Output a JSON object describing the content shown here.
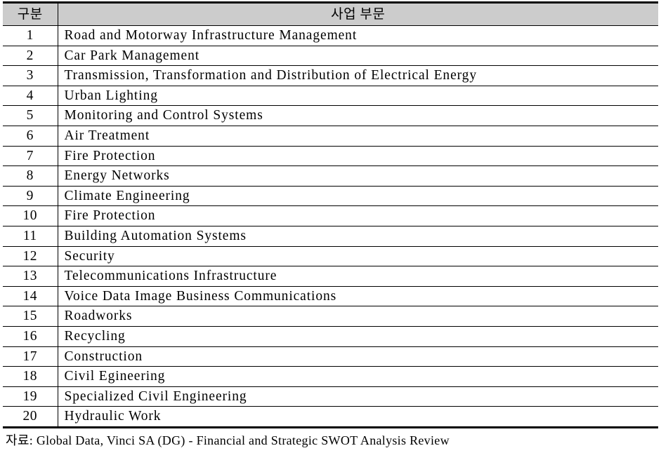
{
  "table": {
    "columns": [
      {
        "key": "no",
        "label": "구분"
      },
      {
        "key": "label",
        "label": "사업 부문"
      }
    ],
    "rows": [
      {
        "no": "1",
        "label": "Road and Motorway Infrastructure Management"
      },
      {
        "no": "2",
        "label": "Car Park Management"
      },
      {
        "no": "3",
        "label": "Transmission, Transformation and Distribution of Electrical Energy"
      },
      {
        "no": "4",
        "label": "Urban Lighting"
      },
      {
        "no": "5",
        "label": "Monitoring and Control Systems"
      },
      {
        "no": "6",
        "label": "Air Treatment"
      },
      {
        "no": "7",
        "label": "Fire Protection"
      },
      {
        "no": "8",
        "label": "Energy Networks"
      },
      {
        "no": "9",
        "label": "Climate Engineering"
      },
      {
        "no": "10",
        "label": "Fire Protection"
      },
      {
        "no": "11",
        "label": "Building Automation Systems"
      },
      {
        "no": "12",
        "label": "Security"
      },
      {
        "no": "13",
        "label": "Telecommunications Infrastructure"
      },
      {
        "no": "14",
        "label": "Voice Data Image Business Communications"
      },
      {
        "no": "15",
        "label": "Roadworks"
      },
      {
        "no": "16",
        "label": "Recycling"
      },
      {
        "no": "17",
        "label": "Construction"
      },
      {
        "no": "18",
        "label": "Civil Egineering"
      },
      {
        "no": "19",
        "label": "Specialized Civil Engineering"
      },
      {
        "no": "20",
        "label": "Hydraulic Work"
      }
    ]
  },
  "footer": {
    "source_note": "자료: Global Data, Vinci SA (DG) - Financial and Strategic SWOT Analysis Review"
  },
  "colors": {
    "header_background": "#cccccc",
    "rule": "#000000",
    "text": "#000000",
    "page_background": "#ffffff"
  }
}
